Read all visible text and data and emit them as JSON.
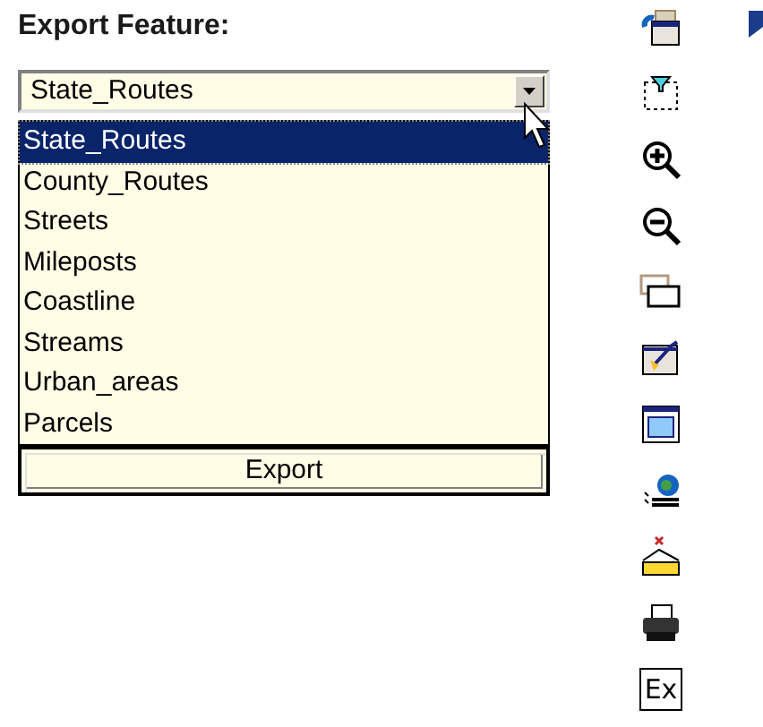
{
  "title": "Export Feature:",
  "select": {
    "value": "State_Routes",
    "expanded": true
  },
  "options": [
    {
      "label": "State_Routes",
      "selected": true
    },
    {
      "label": "County_Routes",
      "selected": false
    },
    {
      "label": "Streets",
      "selected": false
    },
    {
      "label": "Mileposts",
      "selected": false
    },
    {
      "label": "Coastline",
      "selected": false
    },
    {
      "label": "Streams",
      "selected": false
    },
    {
      "label": "Urban_areas",
      "selected": false
    },
    {
      "label": "Parcels",
      "selected": false
    }
  ],
  "export_button": "Export",
  "toolbar": [
    {
      "kind": "refresh"
    },
    {
      "kind": "select"
    },
    {
      "kind": "zoomin"
    },
    {
      "kind": "zoomout"
    },
    {
      "kind": "extent"
    },
    {
      "kind": "clear"
    },
    {
      "kind": "full"
    },
    {
      "kind": "layers"
    },
    {
      "kind": "measure"
    },
    {
      "kind": "print"
    },
    {
      "kind": "export",
      "label": "Ex"
    }
  ]
}
